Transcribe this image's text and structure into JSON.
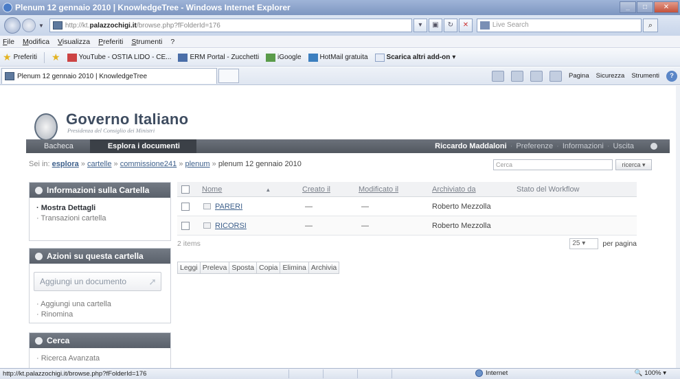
{
  "window": {
    "title": "Plenum 12 gennaio 2010 | KnowledgeTree - Windows Internet Explorer"
  },
  "address": {
    "url_prefix": "http://kt.",
    "url_domain": "palazzochigi.it",
    "url_rest": "/browse.php?fFolderId=176",
    "search_placeholder": "Live Search"
  },
  "menu": [
    "File",
    "Modifica",
    "Visualizza",
    "Preferiti",
    "Strumenti",
    "?"
  ],
  "favorites": {
    "label": "Preferiti",
    "items": [
      "YouTube - OSTIA LIDO - CE...",
      "ERM Portal - Zucchetti",
      "iGoogle",
      "HotMail gratuita",
      "Scarica altri add-on"
    ]
  },
  "tab": {
    "title": "Plenum 12 gennaio 2010 | KnowledgeTree"
  },
  "commandbar": {
    "pagina": "Pagina",
    "sicurezza": "Sicurezza",
    "strumenti": "Strumenti"
  },
  "logo": {
    "title": "Governo Italiano",
    "subtitle": "Presidenza del Consiglio dei Ministri"
  },
  "mainnav": {
    "items": [
      "Bacheca",
      "Esplora i documenti"
    ],
    "user": "Riccardo Maddaloni",
    "links": [
      "Preferenze",
      "Informazioni",
      "Uscita"
    ]
  },
  "breadcrumb": {
    "prefix": "Sei in:",
    "items": [
      "esplora",
      "cartelle",
      "commissione241",
      "plenum"
    ],
    "current": "plenum 12 gennaio 2010"
  },
  "search": {
    "placeholder": "Cerca",
    "button": "ricerca"
  },
  "sidebar": {
    "folder_info": {
      "title": "Informazioni sulla Cartella",
      "items": [
        "Mostra Dettagli",
        "Transazioni cartella"
      ]
    },
    "folder_actions": {
      "title": "Azioni su questa cartella",
      "add_document": "Aggiungi un documento",
      "items": [
        "Aggiungi una cartella",
        "Rinomina"
      ]
    },
    "search_box": {
      "title": "Cerca",
      "items": [
        "Ricerca Avanzata"
      ]
    }
  },
  "listing": {
    "columns": [
      "Nome",
      "Creato il",
      "Modificato il",
      "Archiviato da",
      "Stato del Workflow"
    ],
    "rows": [
      {
        "name": "PARERI",
        "created": "—",
        "modified": "—",
        "owner": "Roberto Mezzolla",
        "workflow": ""
      },
      {
        "name": "RICORSI",
        "created": "—",
        "modified": "—",
        "owner": "Roberto Mezzolla",
        "workflow": ""
      }
    ],
    "item_count": "2 items",
    "per_page_value": "25",
    "per_page_label": "per pagina"
  },
  "actions": [
    "Leggi",
    "Preleva",
    "Sposta",
    "Copia",
    "Elimina",
    "Archivia"
  ],
  "status": {
    "url": "http://kt.palazzochigi.it/browse.php?fFolderId=176",
    "zone": "Internet",
    "zoom": "100%"
  }
}
